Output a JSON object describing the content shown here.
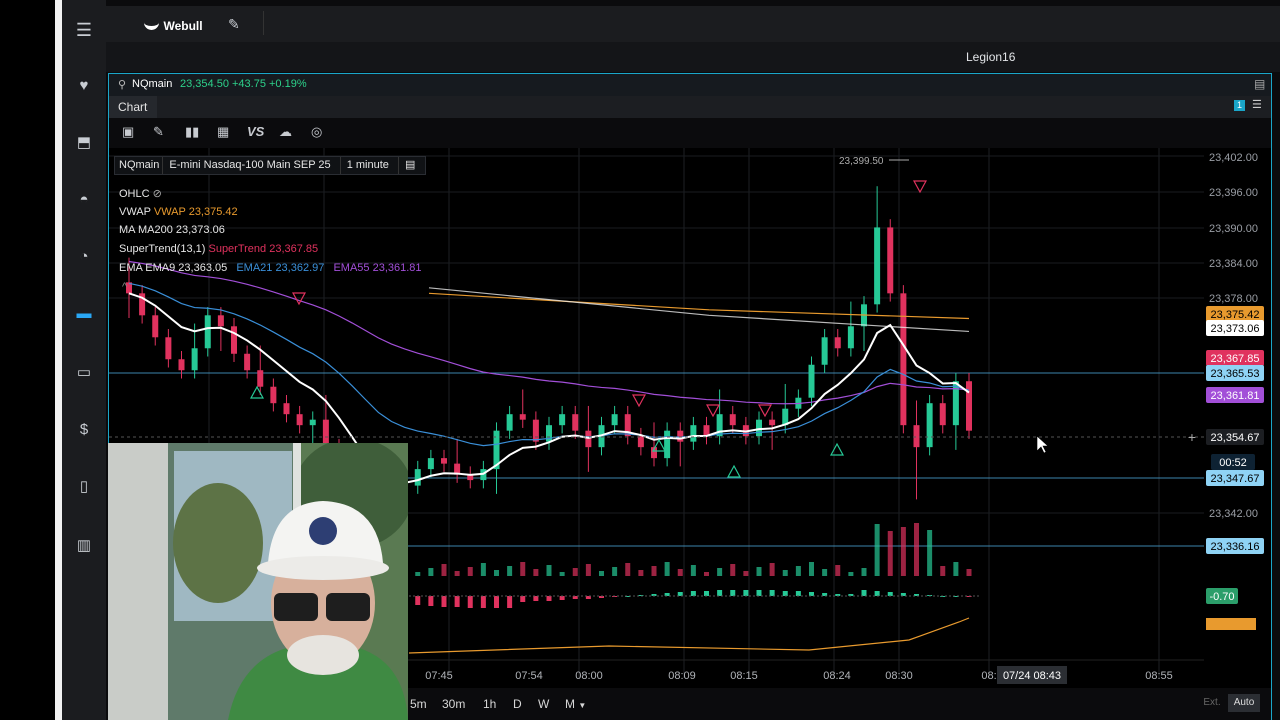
{
  "app": {
    "logo": "Webull",
    "username": "Legion16"
  },
  "symbol_bar": {
    "symbol": "NQmain",
    "quote": "23,354.50 +43.75 +0.19%"
  },
  "tabs": [
    {
      "label": "Chart"
    }
  ],
  "tab_badge": "1",
  "chart_header": {
    "symbol": "NQmain",
    "description": "E-mini Nasdaq-100 Main SEP 25",
    "interval": "1 minute"
  },
  "legend": {
    "ohlc": "OHLC",
    "vwap_label": "VWAP",
    "vwap_value": "VWAP 23,375.42",
    "ma_label": "MA",
    "ma_value": "MA200 23,373.06",
    "st_label": "SuperTrend(13,1)",
    "st_value": "SuperTrend 23,367.85",
    "ema_label": "EMA",
    "ema9": "EMA9 23,363.05",
    "ema21": "EMA21 23,362.97",
    "ema55": "EMA55 23,361.81"
  },
  "timeframes": [
    "5m",
    "30m",
    "1h",
    "D",
    "W",
    "M"
  ],
  "buttons": {
    "ext": "Ext.",
    "auto": "Auto"
  },
  "colors": {
    "up": "#26c996",
    "down": "#e0325e",
    "accent": "#1aa6c9",
    "vwap": "#e89a2e",
    "ema21": "#3a8fd8",
    "ema55": "#a24fd8"
  },
  "chart_data": {
    "type": "candlestick",
    "high_marker": "23,399.50",
    "y_ticks": [
      "23,402.00",
      "23,396.00",
      "23,390.00",
      "23,384.00",
      "23,378.00",
      "23,342.00"
    ],
    "x_ticks": [
      "07:45",
      "07:54",
      "08:00",
      "08:09",
      "08:15",
      "08:24",
      "08:30",
      "08:",
      "08:55"
    ],
    "crosshair_time": "07/24 08:43",
    "price_labels": [
      {
        "value": "23,375.42",
        "series": "VWAP"
      },
      {
        "value": "23,373.06",
        "series": "MA200"
      },
      {
        "value": "23,367.85",
        "series": "SuperTrend"
      },
      {
        "value": "23,365.53",
        "series": "line"
      },
      {
        "value": "23,361.81",
        "series": "EMA55"
      },
      {
        "value": "23,354.67",
        "series": "last"
      },
      {
        "value": "00:52",
        "series": "countdown"
      },
      {
        "value": "23,347.67",
        "series": "line"
      },
      {
        "value": "23,336.16",
        "series": "line"
      }
    ],
    "oscillator_value": "-0.70",
    "ylim": [
      23330,
      23405
    ],
    "closes": [
      23380,
      23376,
      23372,
      23368,
      23366,
      23370,
      23376,
      23374,
      23369,
      23366,
      23363,
      23360,
      23358,
      23356,
      23357,
      23352,
      23345,
      23340,
      23336,
      23334,
      23340,
      23345,
      23348,
      23350,
      23349,
      23347,
      23346,
      23348,
      23355,
      23358,
      23357,
      23353,
      23356,
      23358,
      23355,
      23352,
      23356,
      23358,
      23354,
      23352,
      23350,
      23355,
      23353,
      23356,
      23354,
      23358,
      23356,
      23354,
      23357,
      23356,
      23359,
      23361,
      23367,
      23372,
      23370,
      23374,
      23378,
      23392,
      23380,
      23356,
      23352,
      23360,
      23356,
      23364,
      23355
    ]
  }
}
